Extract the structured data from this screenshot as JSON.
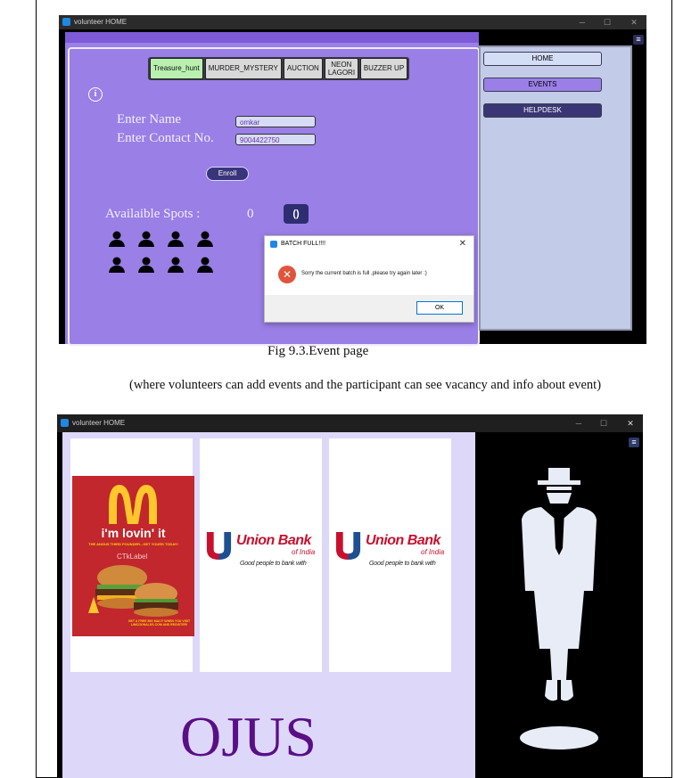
{
  "window1": {
    "title": "volunteer HOME",
    "tabs": [
      {
        "label": "Treasure_hunt",
        "active": true
      },
      {
        "label": "MURDER_MYSTERY",
        "active": false
      },
      {
        "label": "AUCTION",
        "active": false
      },
      {
        "label": "NEON LAGORI",
        "active": false
      },
      {
        "label": "BUZZER UP",
        "active": false
      }
    ],
    "form": {
      "name_label": "Enter Name",
      "name_value": "omkar",
      "contact_label": "Enter Contact No.",
      "contact_value": "9004422750",
      "enroll_label": "Enroll"
    },
    "spots": {
      "label": "Availaible Spots :",
      "value": "0",
      "refresh_glyph": "()"
    },
    "people_icon_count": 8,
    "dialog": {
      "title": "BATCH FULL!!!!",
      "message": "Sorry the current batch is full ,please try again later :)",
      "ok_label": "OK",
      "close_glyph": "✕"
    },
    "nav": [
      {
        "label": "HOME",
        "style": "light"
      },
      {
        "label": "EVENTS",
        "style": "mid"
      },
      {
        "label": "HELPDESK",
        "style": "dark"
      }
    ],
    "colors": {
      "panel": "#9a7fe6",
      "side": "#c2cce8",
      "accent": "#38357a"
    }
  },
  "caption": "Fig 9.3.Event page",
  "subcaption": "(where volunteers can add events and the participant can see vacancy and info about event)",
  "window2": {
    "title": "volunteer HOME",
    "sponsors": {
      "mcdonalds": {
        "slogan": "i'm lovin' it",
        "tagline": "THE ANGUS THIRD POUNDER...GET YOURS TODAY!",
        "overlay": "CTkLabel",
        "footer": "GET A FREE BIG MAC® WHEN YOU VISIT LIMCDONALDS.COM AND REGISTER!"
      },
      "union_bank": {
        "name": "Union Bank",
        "of_india": "of India",
        "tagline": "Good people to bank with"
      }
    },
    "brand": "OJUS"
  }
}
